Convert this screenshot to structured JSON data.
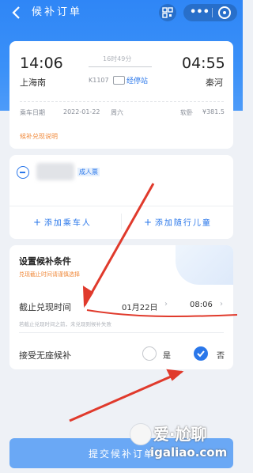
{
  "nav": {
    "back_icon": "chevron-left-icon",
    "title": "候补订单",
    "more_label": "•••"
  },
  "trip": {
    "depart_time": "14:06",
    "depart_station": "上海南",
    "duration": "16时49分",
    "train_no": "K1107",
    "train_tag": "经停站",
    "arrive_time": "04:55",
    "arrive_station": "秦河",
    "date_label": "乘车日期",
    "date": "2022-01-22",
    "weekday": "周六",
    "fare_label": "软卧",
    "fare": "¥381.5",
    "notice": "候补兑现说明"
  },
  "passenger": {
    "name_tag": "成人票",
    "add_passenger": "添加乘车人",
    "add_child": "添加随行儿童"
  },
  "conditions": {
    "heading": "设置候补条件",
    "subtitle": "兑现截止时间请谨慎选择",
    "deadline_label": "截止兑现时间",
    "deadline_date": "01月22日",
    "deadline_time": "08:06",
    "deadline_hint": "若截止兑现时间之前，未兑现则候补失败",
    "standing_label": "接受无座候补",
    "option_no": "是",
    "option_yes": "否"
  },
  "submit_label": "提交候补订单",
  "watermark": {
    "text": "爱·尬聊",
    "url": "igaliao.com"
  },
  "colors": {
    "header": "#2f86f6",
    "accent": "#2a77ea",
    "arrow": "#e03a2c"
  }
}
